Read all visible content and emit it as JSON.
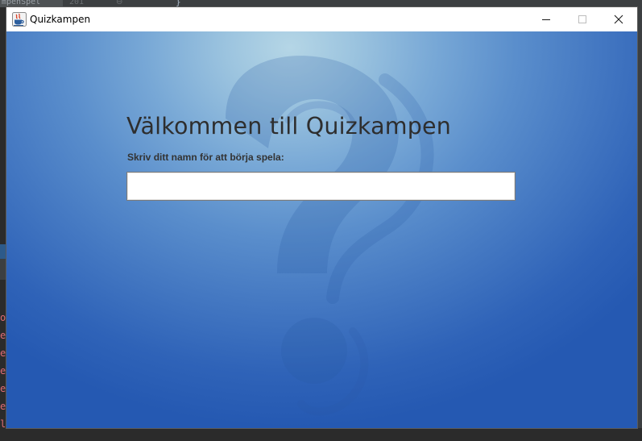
{
  "background_ide": {
    "tab_fragment": "mpenSpel",
    "line_number_fragment": "201",
    "brace_fragment": "}",
    "console_chars": [
      "o",
      "e",
      "e",
      "e",
      "e",
      "e",
      "l"
    ]
  },
  "window": {
    "title": "Quizkampen",
    "controls": [
      "minimize-icon",
      "maximize-icon",
      "close-icon"
    ]
  },
  "main": {
    "heading": "Välkommen till Quizkampen",
    "prompt": "Skriv ditt namn för att börja spela:",
    "name_input": {
      "value": "",
      "placeholder": ""
    }
  },
  "colors": {
    "gradient_light": "#b5d6e6",
    "gradient_dark": "#2559b2",
    "heading_text": "#2e2e2e",
    "console_text": "#e06c75"
  }
}
